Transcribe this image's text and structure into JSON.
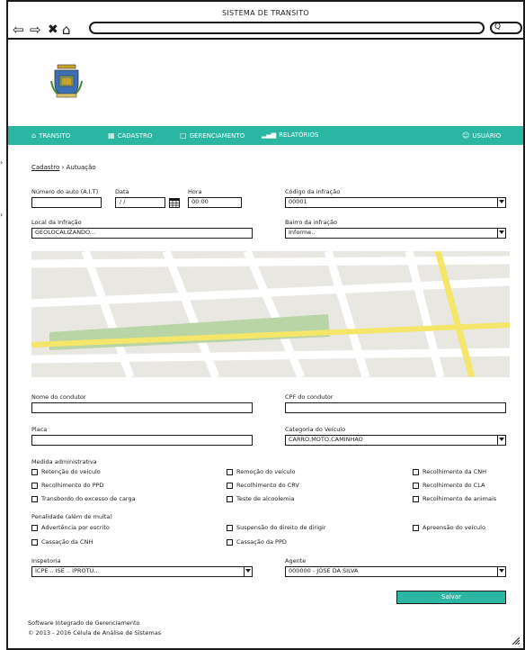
{
  "window": {
    "title": "SISTEMA DE TRANSITO"
  },
  "browser": {
    "search_icon_glyph": "Q"
  },
  "menu": [
    {
      "label": "TRANSITO",
      "icon": "home-icon"
    },
    {
      "label": "CADASTRO",
      "icon": "document-icon"
    },
    {
      "label": "GERENCIAMENTO",
      "icon": "folder-icon"
    },
    {
      "label": "RELATÓRIOS",
      "icon": "bar-chart-icon"
    },
    {
      "label": "USUÁRIO",
      "icon": "user-icon"
    }
  ],
  "breadcrumb": {
    "link": "Cadastro",
    "separator": "›",
    "current": "Autuação"
  },
  "form": {
    "numero_auto": {
      "label": "Número do auto (A.I.T)",
      "value": ""
    },
    "data": {
      "label": "Data",
      "value": "/ /"
    },
    "hora": {
      "label": "Hora",
      "value": "00:00"
    },
    "codigo_infracao": {
      "label": "Código da infração",
      "value": "00001"
    },
    "local_infracao": {
      "label": "Local da Infração",
      "value": "GEOLOCALIZANDO..."
    },
    "bairro_infracao": {
      "label": "Bairro da infração",
      "value": "Informe.."
    },
    "nome_condutor": {
      "label": "Nome do condutor",
      "value": ""
    },
    "cpf_condutor": {
      "label": "CPF do condutor",
      "value": ""
    },
    "placa": {
      "label": "Placa",
      "value": ""
    },
    "categoria_veiculo": {
      "label": "Categoria do Veículo",
      "value": "CARRO,MOTO,CAMINHAO"
    },
    "inspetoria": {
      "label": "Inspetoria",
      "value": "ICPE .. ISE .. IPROTU.."
    },
    "agente": {
      "label": "Agente",
      "value": "000000 - JOSE DA SILVA"
    }
  },
  "medida_administrativa": {
    "title": "Medida administrativa",
    "options": [
      "Retenção do veículo",
      "Remoção do veículo",
      "Recolhimento da CNH",
      "Recolhimento do PPD",
      "Recolhimento do CRV",
      "Recolhimento do CLA",
      "Transbordo do excesso de carga",
      "Teste de alcoolemia",
      "Recolhimento de animais"
    ]
  },
  "penalidade": {
    "title": "Penalidade (além de multa)",
    "options": [
      "Advertência por escrito",
      "Suspensão do direito de dirigir",
      "Apreensão do veículo",
      "Cassação da CNH",
      "Cassação da PPD"
    ]
  },
  "actions": {
    "save_label": "Salvar"
  },
  "footer": {
    "line1": "Software Integrado de Gerenciamento",
    "line2": "© 2013 - 2016 Célula de Análise de Sistemas"
  },
  "colors": {
    "accent": "#2bb5a3",
    "map_background": "#e9e7e2",
    "map_road_yellow": "#f5e66a",
    "map_park": "#b9d4a5"
  }
}
